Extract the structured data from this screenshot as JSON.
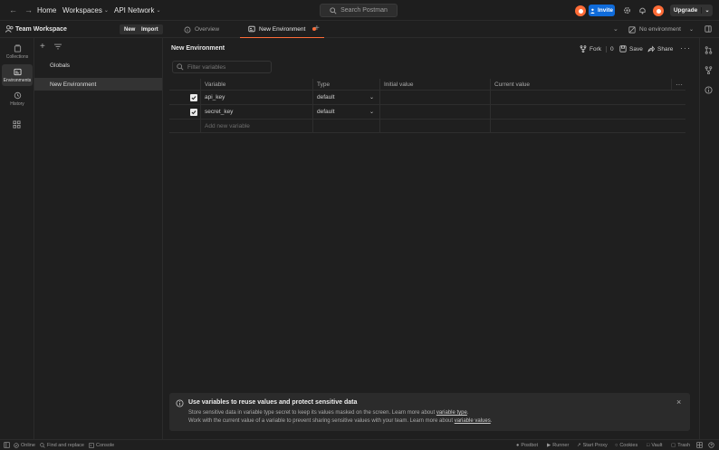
{
  "topbar": {
    "nav_links": [
      "Home",
      "Workspaces",
      "API Network"
    ],
    "search_placeholder": "Search Postman",
    "invite_label": "Invite",
    "upgrade_label": "Upgrade"
  },
  "workspace": {
    "name": "Team Workspace",
    "new_label": "New",
    "import_label": "Import"
  },
  "rail": {
    "items": [
      "Collections",
      "Environments",
      "History"
    ]
  },
  "sidebar": {
    "items": [
      "Globals",
      "New Environment"
    ]
  },
  "tabs": {
    "items": [
      "Overview",
      "New Environment"
    ],
    "environment_selector": "No environment"
  },
  "environment": {
    "title": "New Environment",
    "fork_label": "Fork",
    "fork_count": "0",
    "save_label": "Save",
    "share_label": "Share",
    "filter_placeholder": "Filter variables"
  },
  "table": {
    "headers": [
      "Variable",
      "Type",
      "Initial value",
      "Current value"
    ],
    "rows": [
      {
        "variable": "api_key",
        "type": "default",
        "initial": "",
        "current": ""
      },
      {
        "variable": "secret_key",
        "type": "default",
        "initial": "",
        "current": ""
      }
    ],
    "add_placeholder": "Add new variable"
  },
  "banner": {
    "title": "Use variables to reuse values and protect sensitive data",
    "line1_text": "Store sensitive data in variable type secret to keep its values masked on the screen. Learn more about ",
    "line1_link": "variable type",
    "line2_text": "Work with the current value of a variable to prevent sharing sensitive values with your team. Learn more about ",
    "line2_link": "variable values"
  },
  "statusbar": {
    "left": [
      "Online",
      "Find and replace",
      "Console"
    ],
    "right": [
      "Postbot",
      "Runner",
      "Start Proxy",
      "Cookies",
      "Vault",
      "Trash"
    ]
  },
  "colors": {
    "accent": "#ff6c37",
    "invite_blue": "#0f6bda",
    "background": "#1f1f1f"
  }
}
